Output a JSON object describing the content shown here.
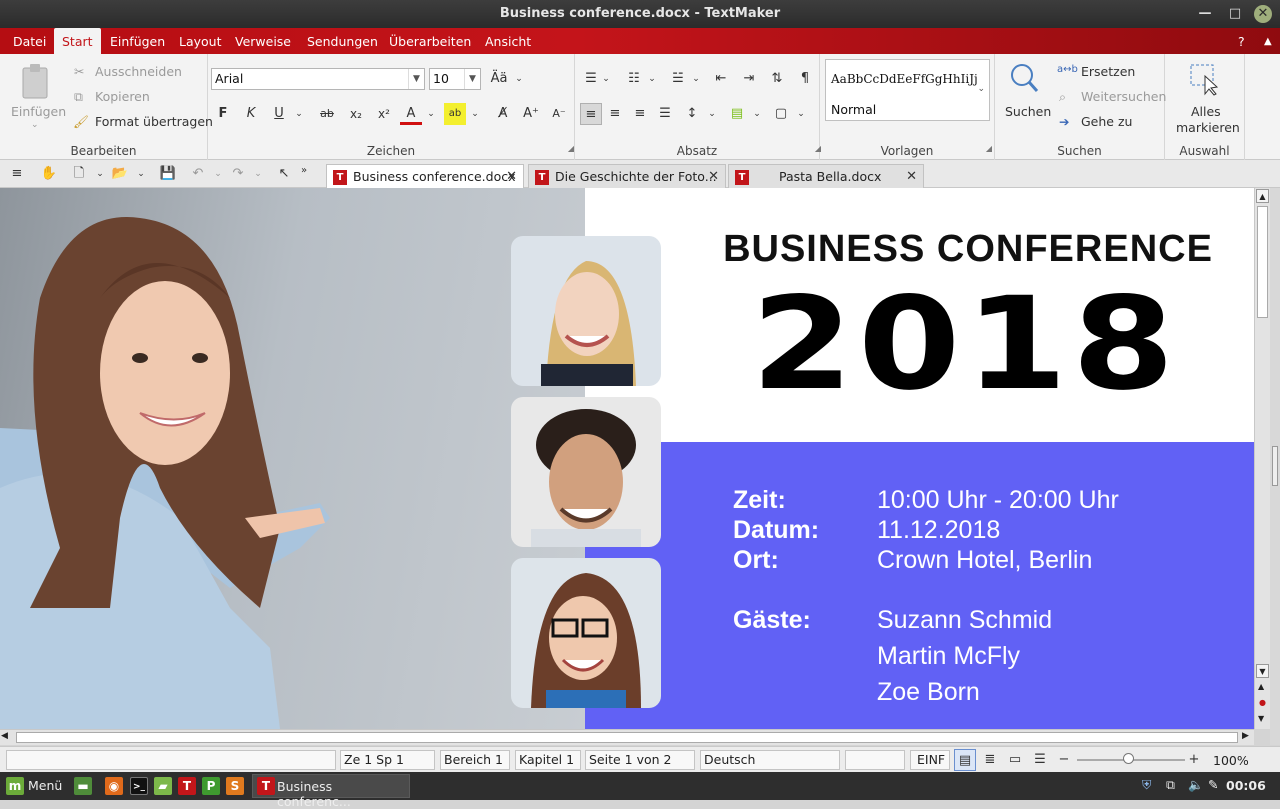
{
  "window": {
    "title": "Business conference.docx - TextMaker"
  },
  "menu": [
    "Datei",
    "Start",
    "Einfügen",
    "Layout",
    "Verweise",
    "Sendungen",
    "Überarbeiten",
    "Ansicht"
  ],
  "ribbon": {
    "bearbeiten": {
      "label": "Bearbeiten",
      "paste": "Einfügen",
      "cut": "Ausschneiden",
      "copy": "Kopieren",
      "format_painter": "Format übertragen"
    },
    "zeichen": {
      "label": "Zeichen",
      "font": "Arial",
      "size": "10",
      "bold": "F",
      "italic": "K",
      "underline": "U"
    },
    "absatz": {
      "label": "Absatz"
    },
    "vorlagen": {
      "label": "Vorlagen",
      "preview": "AaBbCcDdEeFfGgHhIiJj",
      "style": "Normal"
    },
    "suchen": {
      "label": "Suchen",
      "search": "Suchen",
      "replace": "Ersetzen",
      "find_next": "Weitersuchen",
      "goto": "Gehe zu"
    },
    "auswahl": {
      "label": "Auswahl",
      "select_all_1": "Alles",
      "select_all_2": "markieren"
    }
  },
  "tabs": [
    {
      "label": "Business conference.docx",
      "active": true
    },
    {
      "label": "Die Geschichte der Foto...",
      "active": false
    },
    {
      "label": "Pasta Bella.docx",
      "active": false
    }
  ],
  "document": {
    "heading": "BUSINESS CONFERENCE",
    "year": "2018",
    "accent_color": "#6161f5",
    "zeit_label": "Zeit:",
    "zeit_value": "10:00 Uhr - 20:00 Uhr",
    "datum_label": "Datum:",
    "datum_value": "11.12.2018",
    "ort_label": "Ort:",
    "ort_value": "Crown Hotel, Berlin",
    "gaeste_label": "Gäste:",
    "guests": [
      "Suzann Schmid",
      "Martin McFly",
      "Zoe Born"
    ]
  },
  "status": {
    "position": "Ze 1 Sp 1",
    "bereich": "Bereich 1",
    "kapitel": "Kapitel 1",
    "seite": "Seite 1 von 2",
    "language": "Deutsch (Deutschland)",
    "mode": "EINF",
    "zoom": "100%"
  },
  "taskbar": {
    "menu": "Menü",
    "window": "Business conferenc...",
    "time": "00:06"
  }
}
